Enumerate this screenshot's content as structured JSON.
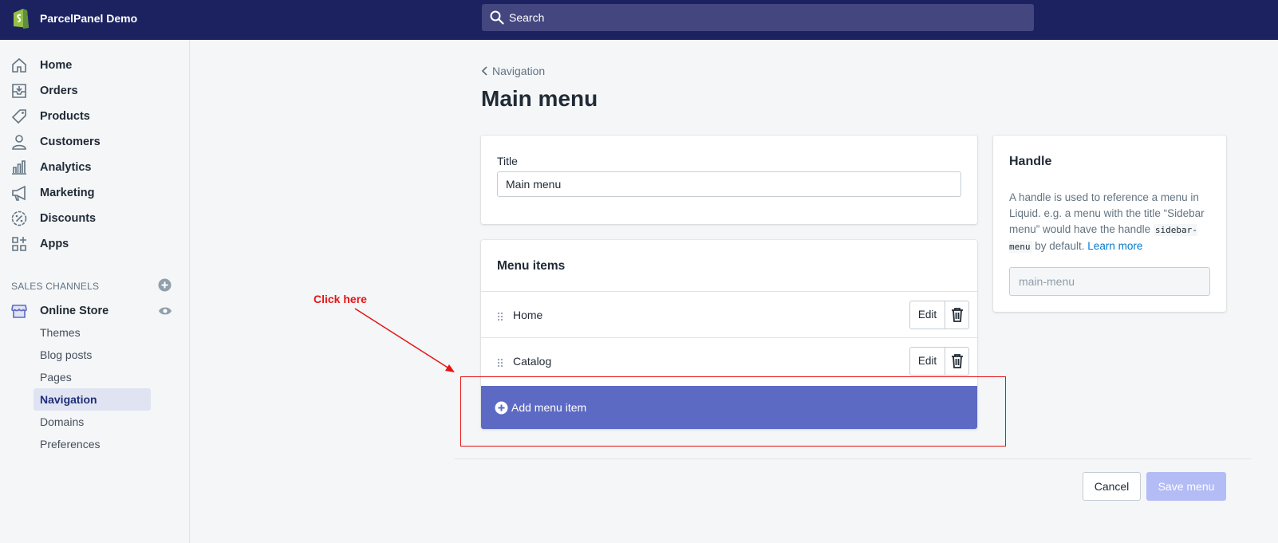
{
  "topbar": {
    "store_name": "ParcelPanel Demo",
    "search_placeholder": "Search",
    "brand_color": "#1c2260"
  },
  "sidebar": {
    "items": [
      {
        "label": "Home",
        "icon": "home-icon"
      },
      {
        "label": "Orders",
        "icon": "orders-icon"
      },
      {
        "label": "Products",
        "icon": "tag-icon"
      },
      {
        "label": "Customers",
        "icon": "person-icon"
      },
      {
        "label": "Analytics",
        "icon": "bar-chart-icon"
      },
      {
        "label": "Marketing",
        "icon": "megaphone-icon"
      },
      {
        "label": "Discounts",
        "icon": "discount-icon"
      },
      {
        "label": "Apps",
        "icon": "apps-icon"
      }
    ],
    "sales_channels_label": "SALES CHANNELS",
    "online_store_label": "Online Store",
    "sub_items": [
      {
        "label": "Themes"
      },
      {
        "label": "Blog posts"
      },
      {
        "label": "Pages"
      },
      {
        "label": "Navigation",
        "active": true
      },
      {
        "label": "Domains"
      },
      {
        "label": "Preferences"
      }
    ]
  },
  "main": {
    "back_label": "Navigation",
    "page_title": "Main menu",
    "title_card": {
      "label": "Title",
      "value": "Main menu"
    },
    "menu_items_card": {
      "header": "Menu items",
      "rows": [
        {
          "label": "Home",
          "edit_label": "Edit"
        },
        {
          "label": "Catalog",
          "edit_label": "Edit"
        }
      ],
      "add_label": "Add menu item",
      "accent_color": "#5c6ac4"
    },
    "handle_card": {
      "title": "Handle",
      "desc_part1": "A handle is used to reference a menu in Liquid. e.g. a menu with the title “Sidebar menu” would have the handle ",
      "code": "sidebar-menu",
      "desc_part2": " by default. ",
      "learn_more": "Learn more",
      "value": "main-menu"
    },
    "cancel_label": "Cancel",
    "save_label": "Save menu"
  },
  "annotation": {
    "text": "Click here",
    "color": "#e61414"
  }
}
